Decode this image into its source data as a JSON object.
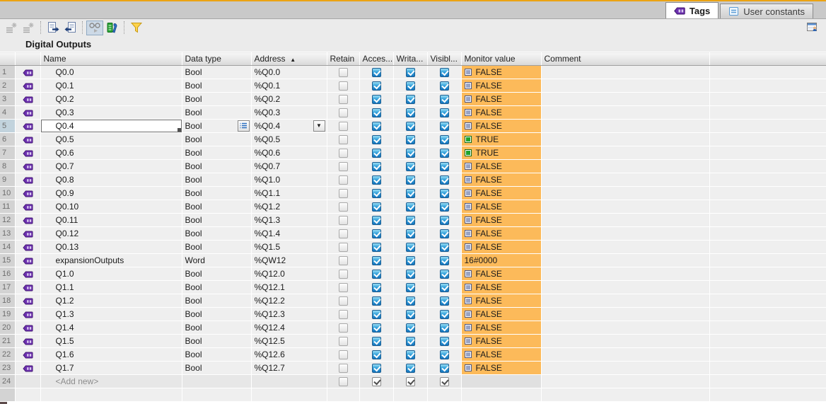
{
  "tabs": [
    {
      "label": "Tags",
      "icon": "tag-icon",
      "active": true
    },
    {
      "label": "User constants",
      "icon": "constant-icon",
      "active": false
    }
  ],
  "toolbar": {
    "buttons": [
      "insert-row-icon",
      "add-row-icon",
      "export-icon",
      "import-icon",
      "monitor-all-icon",
      "retain-settings-icon",
      "filter-icon"
    ],
    "right_button": "user-table-view-icon"
  },
  "title": "Digital Outputs",
  "colors": {
    "top_accent": "#eba313",
    "monitor_orange": "#fcba5a",
    "checkbox_blue": "#1373bd",
    "true_green": "#1fa42c",
    "false_slate": "#98a3c4",
    "selected_row": "#c2d3dd"
  },
  "table": {
    "headers": {
      "name": "Name",
      "data_type": "Data type",
      "address": "Address",
      "sort_indicator": "▲",
      "retain": "Retain",
      "accessible": "Acces...",
      "writable": "Writa...",
      "visible": "Visibl...",
      "monitor_value": "Monitor value",
      "comment": "Comment"
    },
    "rows": [
      {
        "num": "1",
        "name": "Q0.0",
        "data_type": "Bool",
        "address": "%Q0.0",
        "retain": false,
        "accessible": true,
        "writable": true,
        "visible": true,
        "monitor": "FALSE",
        "monitor_state": "false",
        "style": "normal"
      },
      {
        "num": "2",
        "name": "Q0.1",
        "data_type": "Bool",
        "address": "%Q0.1",
        "retain": false,
        "accessible": true,
        "writable": true,
        "visible": true,
        "monitor": "FALSE",
        "monitor_state": "false",
        "style": "normal"
      },
      {
        "num": "3",
        "name": "Q0.2",
        "data_type": "Bool",
        "address": "%Q0.2",
        "retain": false,
        "accessible": true,
        "writable": true,
        "visible": true,
        "monitor": "FALSE",
        "monitor_state": "false",
        "style": "normal"
      },
      {
        "num": "4",
        "name": "Q0.3",
        "data_type": "Bool",
        "address": "%Q0.3",
        "retain": false,
        "accessible": true,
        "writable": true,
        "visible": true,
        "monitor": "FALSE",
        "monitor_state": "false",
        "style": "normal"
      },
      {
        "num": "5",
        "name": "Q0.4",
        "data_type": "Bool",
        "address": "%Q0.4",
        "retain": false,
        "accessible": true,
        "writable": true,
        "visible": true,
        "monitor": "FALSE",
        "monitor_state": "false",
        "style": "selected"
      },
      {
        "num": "6",
        "name": "Q0.5",
        "data_type": "Bool",
        "address": "%Q0.5",
        "retain": false,
        "accessible": true,
        "writable": true,
        "visible": true,
        "monitor": "TRUE",
        "monitor_state": "true",
        "style": "normal"
      },
      {
        "num": "7",
        "name": "Q0.6",
        "data_type": "Bool",
        "address": "%Q0.6",
        "retain": false,
        "accessible": true,
        "writable": true,
        "visible": true,
        "monitor": "TRUE",
        "monitor_state": "true",
        "style": "normal"
      },
      {
        "num": "8",
        "name": "Q0.7",
        "data_type": "Bool",
        "address": "%Q0.7",
        "retain": false,
        "accessible": true,
        "writable": true,
        "visible": true,
        "monitor": "FALSE",
        "monitor_state": "false",
        "style": "normal"
      },
      {
        "num": "9",
        "name": "Q0.8",
        "data_type": "Bool",
        "address": "%Q1.0",
        "retain": false,
        "accessible": true,
        "writable": true,
        "visible": true,
        "monitor": "FALSE",
        "monitor_state": "false",
        "style": "normal"
      },
      {
        "num": "10",
        "name": "Q0.9",
        "data_type": "Bool",
        "address": "%Q1.1",
        "retain": false,
        "accessible": true,
        "writable": true,
        "visible": true,
        "monitor": "FALSE",
        "monitor_state": "false",
        "style": "normal"
      },
      {
        "num": "11",
        "name": "Q0.10",
        "data_type": "Bool",
        "address": "%Q1.2",
        "retain": false,
        "accessible": true,
        "writable": true,
        "visible": true,
        "monitor": "FALSE",
        "monitor_state": "false",
        "style": "normal"
      },
      {
        "num": "12",
        "name": "Q0.11",
        "data_type": "Bool",
        "address": "%Q1.3",
        "retain": false,
        "accessible": true,
        "writable": true,
        "visible": true,
        "monitor": "FALSE",
        "monitor_state": "false",
        "style": "normal"
      },
      {
        "num": "13",
        "name": "Q0.12",
        "data_type": "Bool",
        "address": "%Q1.4",
        "retain": false,
        "accessible": true,
        "writable": true,
        "visible": true,
        "monitor": "FALSE",
        "monitor_state": "false",
        "style": "normal"
      },
      {
        "num": "14",
        "name": "Q0.13",
        "data_type": "Bool",
        "address": "%Q1.5",
        "retain": false,
        "accessible": true,
        "writable": true,
        "visible": true,
        "monitor": "FALSE",
        "monitor_state": "false",
        "style": "normal"
      },
      {
        "num": "15",
        "name": "expansionOutputs",
        "data_type": "Word",
        "address": "%QW12",
        "retain": false,
        "accessible": true,
        "writable": true,
        "visible": true,
        "monitor": "16#0000",
        "monitor_state": "value",
        "style": "normal"
      },
      {
        "num": "16",
        "name": "Q1.0",
        "data_type": "Bool",
        "address": "%Q12.0",
        "retain": false,
        "accessible": true,
        "writable": true,
        "visible": true,
        "monitor": "FALSE",
        "monitor_state": "false",
        "style": "normal"
      },
      {
        "num": "17",
        "name": "Q1.1",
        "data_type": "Bool",
        "address": "%Q12.1",
        "retain": false,
        "accessible": true,
        "writable": true,
        "visible": true,
        "monitor": "FALSE",
        "monitor_state": "false",
        "style": "normal"
      },
      {
        "num": "18",
        "name": "Q1.2",
        "data_type": "Bool",
        "address": "%Q12.2",
        "retain": false,
        "accessible": true,
        "writable": true,
        "visible": true,
        "monitor": "FALSE",
        "monitor_state": "false",
        "style": "normal"
      },
      {
        "num": "19",
        "name": "Q1.3",
        "data_type": "Bool",
        "address": "%Q12.3",
        "retain": false,
        "accessible": true,
        "writable": true,
        "visible": true,
        "monitor": "FALSE",
        "monitor_state": "false",
        "style": "normal"
      },
      {
        "num": "20",
        "name": "Q1.4",
        "data_type": "Bool",
        "address": "%Q12.4",
        "retain": false,
        "accessible": true,
        "writable": true,
        "visible": true,
        "monitor": "FALSE",
        "monitor_state": "false",
        "style": "normal"
      },
      {
        "num": "21",
        "name": "Q1.5",
        "data_type": "Bool",
        "address": "%Q12.5",
        "retain": false,
        "accessible": true,
        "writable": true,
        "visible": true,
        "monitor": "FALSE",
        "monitor_state": "false",
        "style": "normal"
      },
      {
        "num": "22",
        "name": "Q1.6",
        "data_type": "Bool",
        "address": "%Q12.6",
        "retain": false,
        "accessible": true,
        "writable": true,
        "visible": true,
        "monitor": "FALSE",
        "monitor_state": "false",
        "style": "normal"
      },
      {
        "num": "23",
        "name": "Q1.7",
        "data_type": "Bool",
        "address": "%Q12.7",
        "retain": false,
        "accessible": true,
        "writable": true,
        "visible": true,
        "monitor": "FALSE",
        "monitor_state": "false",
        "style": "normal"
      },
      {
        "num": "24",
        "name": "<Add new>",
        "data_type": "",
        "address": "",
        "retain": false,
        "accessible": true,
        "writable": true,
        "visible": true,
        "monitor": "",
        "monitor_state": "none",
        "style": "addnew"
      }
    ]
  }
}
